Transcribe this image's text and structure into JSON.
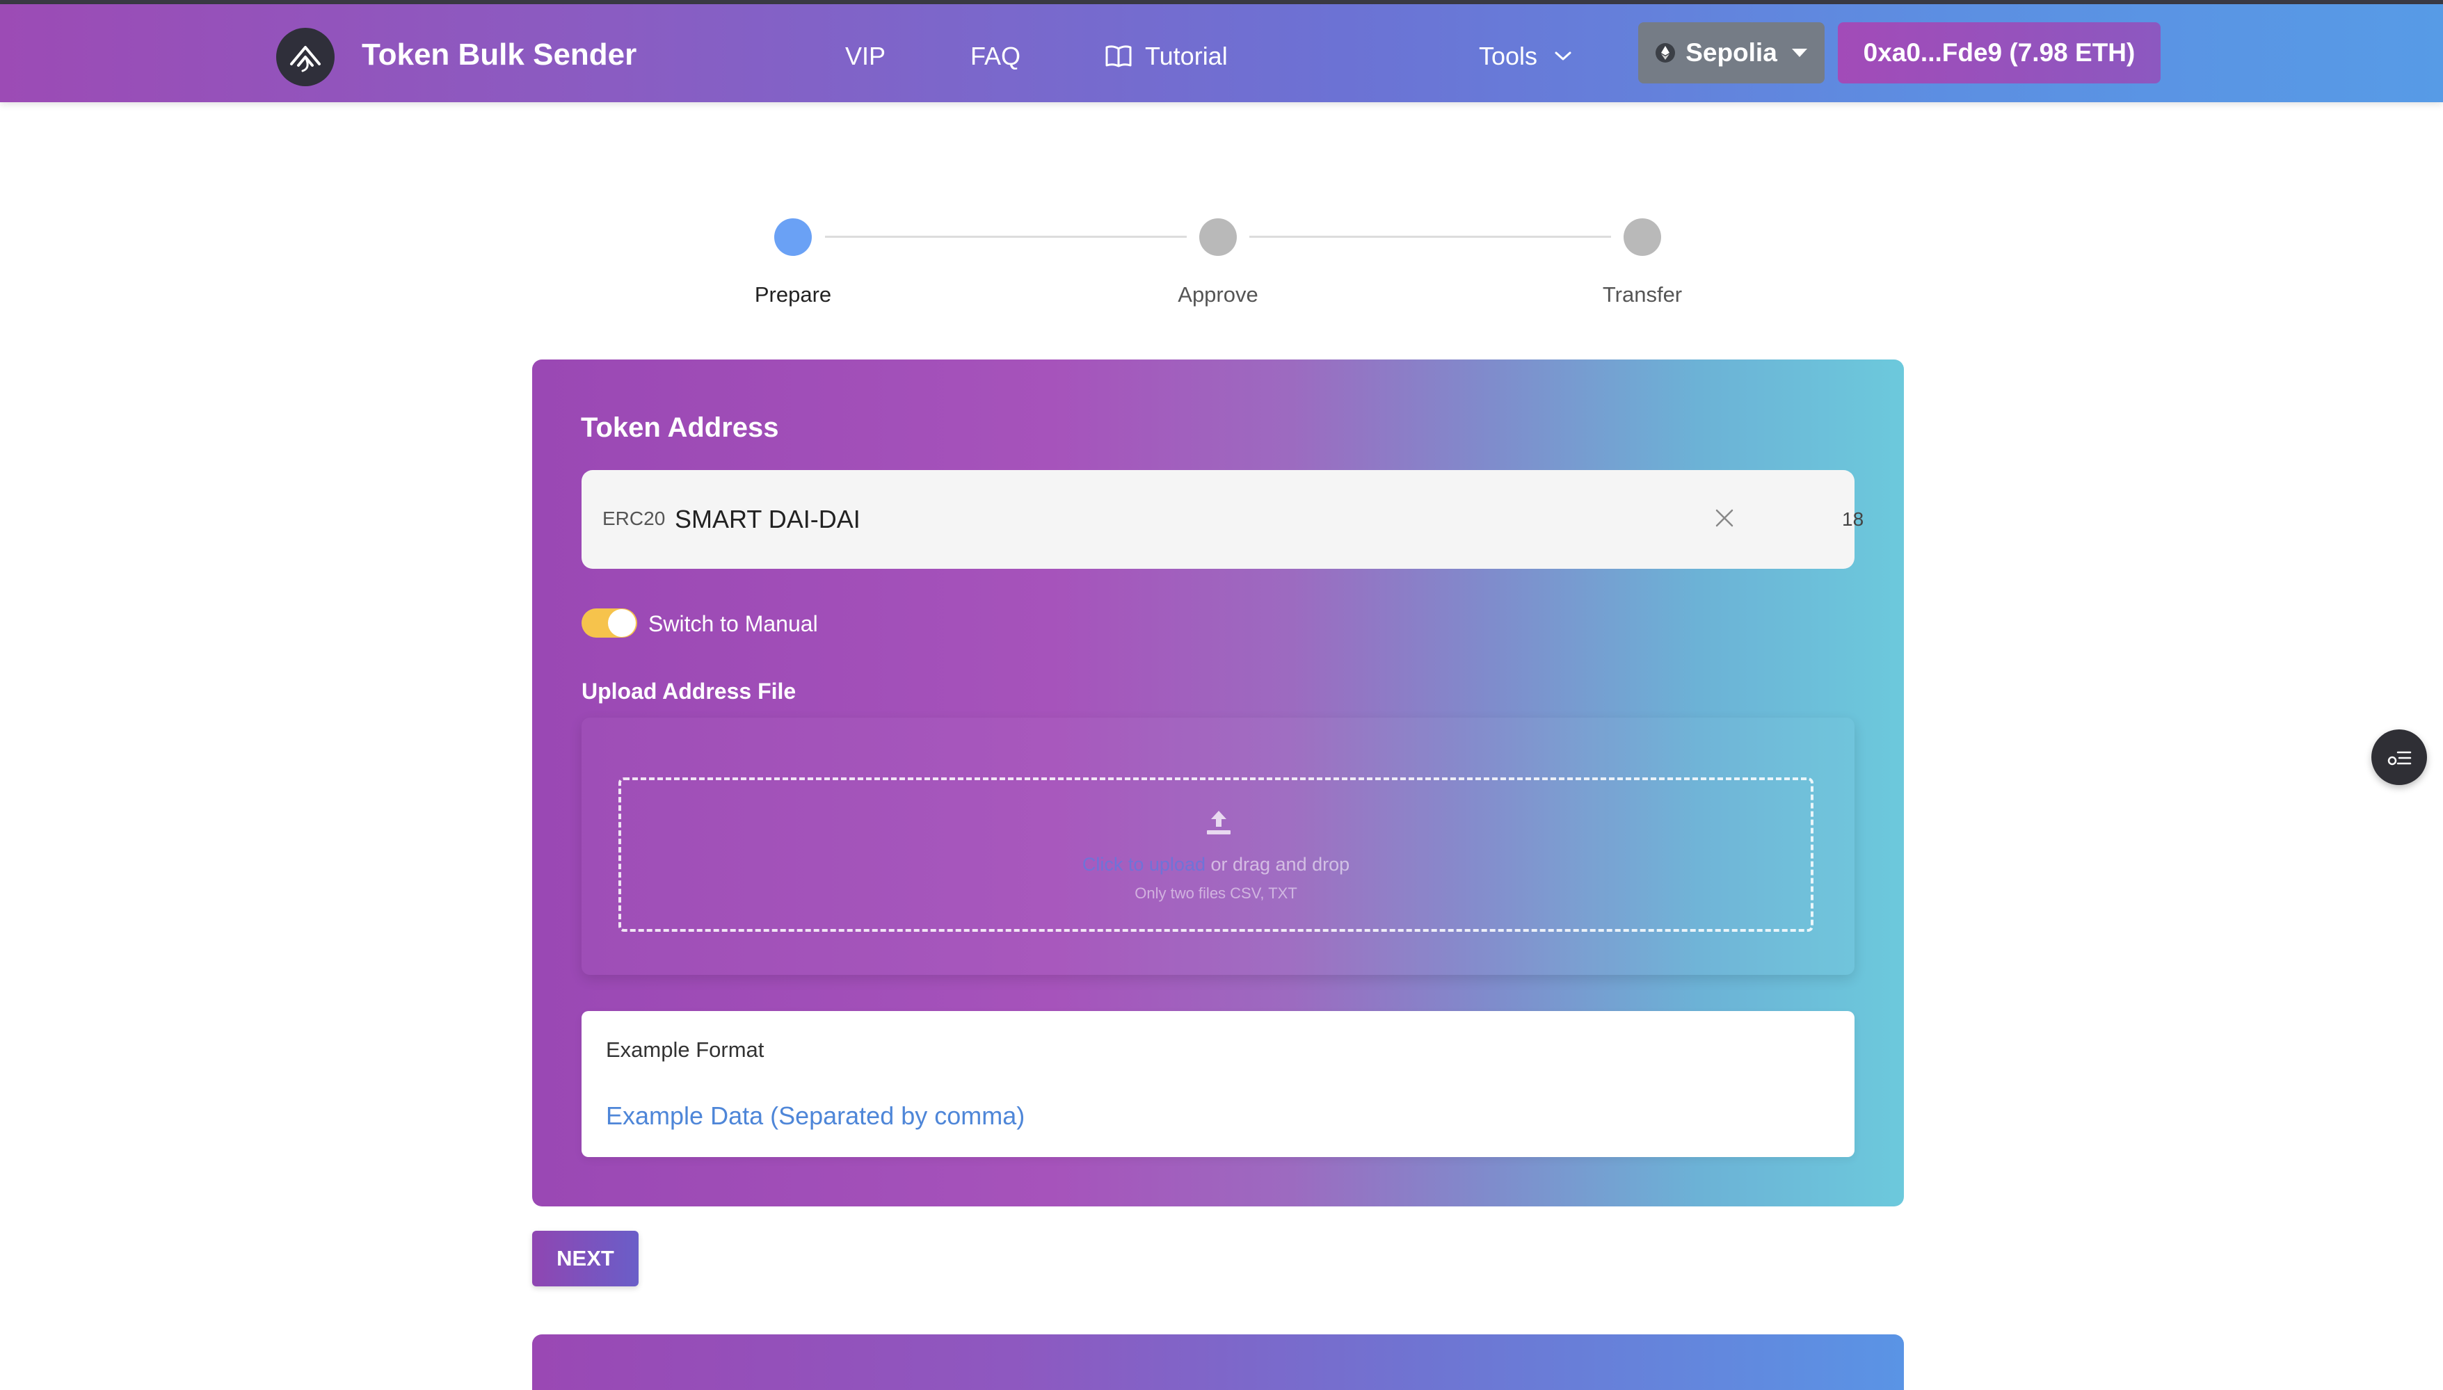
{
  "header": {
    "brand": "Token Bulk Sender",
    "nav": {
      "vip": "VIP",
      "faq": "FAQ",
      "tutorial": "Tutorial",
      "tools": "Tools"
    },
    "network": "Sepolia",
    "wallet": "0xa0...Fde9 (7.98 ETH)"
  },
  "stepper": {
    "steps": [
      "Prepare",
      "Approve",
      "Transfer"
    ],
    "active_index": 0
  },
  "form": {
    "title": "Token Address",
    "token_type": "ERC20",
    "token_value": "SMART DAI-DAI",
    "decimals": "18",
    "toggle_label": "Switch to Manual",
    "toggle_on": true,
    "upload_label": "Upload Address File",
    "dropzone": {
      "click_text": "Click to upload",
      "drag_text": " or drag and drop",
      "hint": "Only two files CSV, TXT"
    },
    "example": {
      "title": "Example Format",
      "link": "Example Data (Separated by comma)"
    }
  },
  "actions": {
    "next": "NEXT"
  },
  "icons": {
    "logo": "mountain-logo-icon",
    "tutorial": "book-icon",
    "tools": "chevron-down-icon",
    "network": "ethereum-icon",
    "clear": "close-icon",
    "upload": "upload-icon",
    "float": "toggle-menu-icon"
  },
  "colors": {
    "accent_blue": "#6aa1f5",
    "toggle_on": "#f6c34c",
    "link": "#4e86d8"
  }
}
